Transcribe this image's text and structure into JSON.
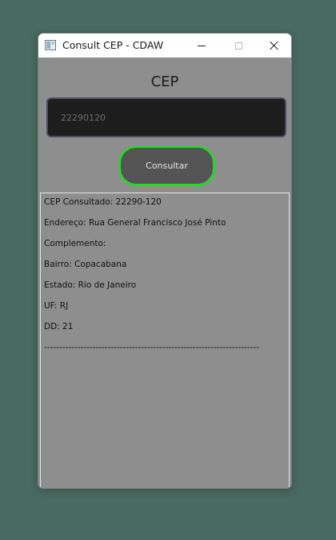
{
  "window": {
    "title": "Consult CEP - CDAW"
  },
  "form": {
    "heading": "CEP",
    "cep_value": "22290120",
    "consult_label": "Consultar"
  },
  "result": {
    "lines": [
      "CEP Consultado: 22290-120",
      "Endereço: Rua General Francisco José Pinto",
      "Complemento:",
      "Bairro: Copacabana",
      "Estado: Rio de Janeiro",
      "UF: RJ",
      "DD: 21",
      "-----------------------------------------------------------------------"
    ]
  },
  "colors": {
    "desktop": "#496a60",
    "window_body": "#8e8e8e",
    "input_bg": "#1d1d1d",
    "button_bg": "#545454",
    "button_border": "#2fd32f"
  }
}
